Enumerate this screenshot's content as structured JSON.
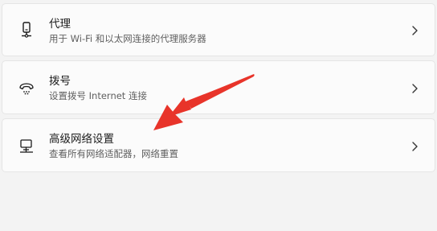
{
  "settings": {
    "items": [
      {
        "title": "代理",
        "subtitle": "用于 Wi-Fi 和以太网连接的代理服务器",
        "icon": "proxy-server-icon"
      },
      {
        "title": "拨号",
        "subtitle": "设置拨号 Internet 连接",
        "icon": "dial-up-icon"
      },
      {
        "title": "高级网络设置",
        "subtitle": "查看所有网络适配器，网络重置",
        "icon": "network-adapter-icon"
      }
    ]
  },
  "colors": {
    "annotation_arrow": "#e8342a",
    "card_background": "#fbfbfb",
    "page_background": "#f3f3f3"
  }
}
